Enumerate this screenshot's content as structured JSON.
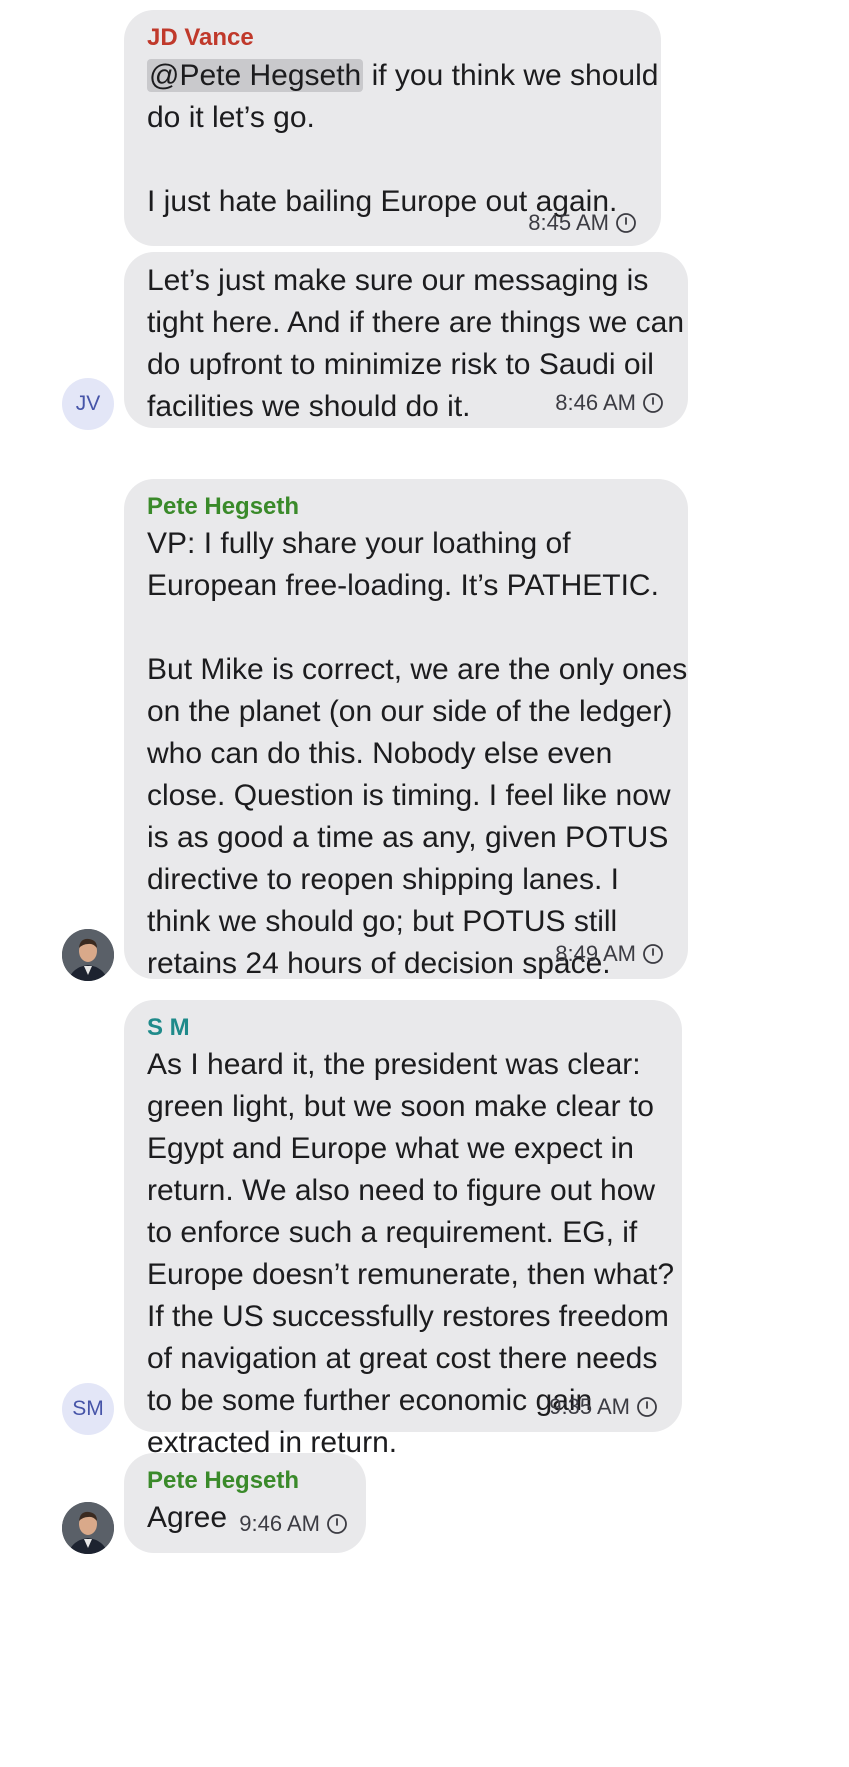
{
  "messages": [
    {
      "sender": "JD Vance",
      "sender_color": "#c0392b",
      "mention": "@Pete Hegseth",
      "text": " if you think we should\ndo it let’s go.\n\nI just hate bailing Europe out again.",
      "time": "8:45 AM"
    },
    {
      "text": "Let’s just make sure our messaging is\ntight here. And if there are things we can\ndo upfront to minimize risk to Saudi oil\nfacilities we should do it.",
      "time": "8:46 AM",
      "avatar": "JV"
    },
    {
      "sender": "Pete Hegseth",
      "sender_color": "#3a8a2a",
      "text": "VP: I fully share your loathing of\nEuropean free-loading. It’s PATHETIC.\n\nBut Mike is correct, we are the only ones\non the planet (on our side of the ledger)\nwho can do this. Nobody else even\nclose. Question is timing. I feel like now\nis as good a time as any, given POTUS\ndirective to reopen shipping lanes. I\nthink we should go; but POTUS still\nretains 24 hours of decision space.",
      "time": "8:49 AM"
    },
    {
      "sender": "S M",
      "sender_color": "#1f8a8a",
      "text": "As I heard it, the president was clear:\ngreen light, but we soon make clear to\nEgypt and Europe what we expect in\nreturn. We also need to figure out how\nto enforce such a requirement. EG, if\nEurope doesn’t remunerate, then what?\nIf the US successfully restores freedom\nof navigation at great cost there needs\nto be some further economic gain\nextracted in return.",
      "time": "9:35 AM",
      "avatar": "SM"
    },
    {
      "sender": "Pete Hegseth",
      "sender_color": "#3a8a2a",
      "text": "Agree",
      "time": "9:46 AM"
    }
  ]
}
